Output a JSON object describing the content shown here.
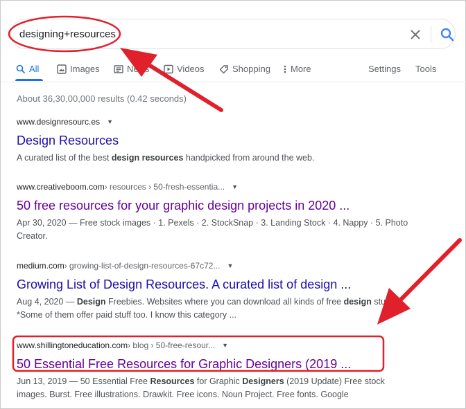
{
  "search": {
    "query": "designing+resources",
    "clear_icon": "close-icon",
    "submit_icon": "search-icon"
  },
  "tabs": [
    {
      "label": "All",
      "icon": "search-icon",
      "active": true
    },
    {
      "label": "Images",
      "icon": "image-icon"
    },
    {
      "label": "News",
      "icon": "newspaper-icon"
    },
    {
      "label": "Videos",
      "icon": "play-icon"
    },
    {
      "label": "Shopping",
      "icon": "tag-icon"
    },
    {
      "label": "More",
      "icon": "more-vertical-icon"
    }
  ],
  "tools": {
    "settings": "Settings",
    "tools": "Tools"
  },
  "result_stats": "About 36,30,00,000 results (0.42 seconds)",
  "results": [
    {
      "domain": "www.designresourc.es",
      "crumbs": "",
      "title": "Design Resources",
      "snippet_parts": [
        {
          "t": "A curated list of the best "
        },
        {
          "t": "design resources",
          "b": true
        },
        {
          "t": " handpicked from around the web."
        }
      ]
    },
    {
      "domain": "www.creativeboom.com",
      "crumbs": " › resources › 50-fresh-essentia...",
      "title": "50 free resources for your graphic design projects in 2020 ...",
      "snippet_parts": [
        {
          "t": "Apr 30, 2020 — Free stock images · 1. Pexels · 2. StockSnap · 3. Landing Stock · 4. Nappy · 5. Photo Creator."
        }
      ]
    },
    {
      "domain": "medium.com",
      "crumbs": " › growing-list-of-design-resources-67c72...",
      "title": "Growing List of Design Resources. A curated list of design ...",
      "snippet_parts": [
        {
          "t": "Aug 4, 2020 — "
        },
        {
          "t": "Design",
          "b": true
        },
        {
          "t": " Freebies. Websites where you can download all kinds of free "
        },
        {
          "t": "design",
          "b": true
        },
        {
          "t": " stuff. *Some of them offer paid stuff too. I know this category ..."
        }
      ]
    },
    {
      "domain": "www.shillingtoneducation.com",
      "crumbs": " › blog › 50-free-resour...",
      "title": "50 Essential Free Resources for Graphic Designers (2019 ...",
      "snippet_parts": [
        {
          "t": "Jun 13, 2019 — 50 Essential Free "
        },
        {
          "t": "Resources",
          "b": true
        },
        {
          "t": " for Graphic "
        },
        {
          "t": "Designers",
          "b": true
        },
        {
          "t": " (2019 Update) Free stock images. Burst. Free illustrations. Drawkit. Free icons. Noun Project. Free fonts. Google"
        }
      ]
    }
  ],
  "colors": {
    "link_blue": "#1a0dab",
    "link_visited": "#660099",
    "accent_blue": "#1a73e8",
    "annotation_red": "#e0202a"
  }
}
